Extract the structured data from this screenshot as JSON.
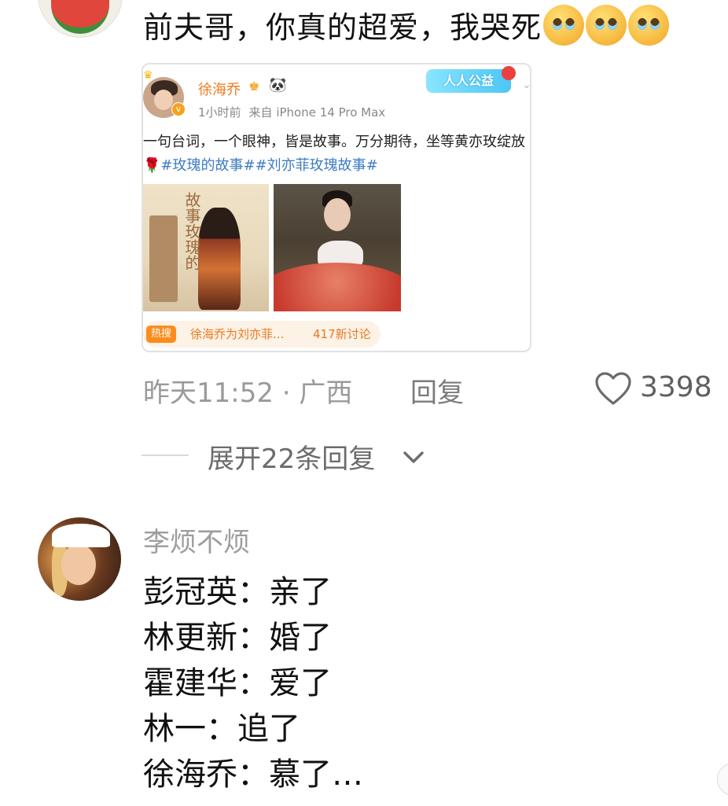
{
  "top_comment": {
    "text": "前夫哥，你真的超爱，我哭死",
    "emojis": [
      "crying-face",
      "crying-face",
      "crying-face"
    ]
  },
  "card": {
    "username": "徐海乔",
    "time": "1小时前",
    "source": "来自 iPhone 14 Pro Max",
    "charity_badge": "人人公益",
    "text": "一句台词，一个眼神，皆是故事。万分期待，坐等黄亦玫绽放",
    "hashtags": [
      "#玫瑰的故事#",
      "#刘亦菲玫瑰故事#"
    ],
    "image1_title": "故事玫瑰的",
    "hot_badge": "热搜",
    "hot_title": "徐海乔为刘亦菲...",
    "hot_count": "417新讨论"
  },
  "actions": {
    "time_location": "昨天11:52 · 广西",
    "reply_label": "回复",
    "like_count": "3398"
  },
  "expand": {
    "label": "展开22条回复"
  },
  "comment2": {
    "username": "李烦不烦",
    "lines": [
      "彭冠英：亲了",
      "林更新：婚了",
      "霍建华：爱了",
      "林一：追了",
      "徐海乔：慕了…"
    ]
  }
}
